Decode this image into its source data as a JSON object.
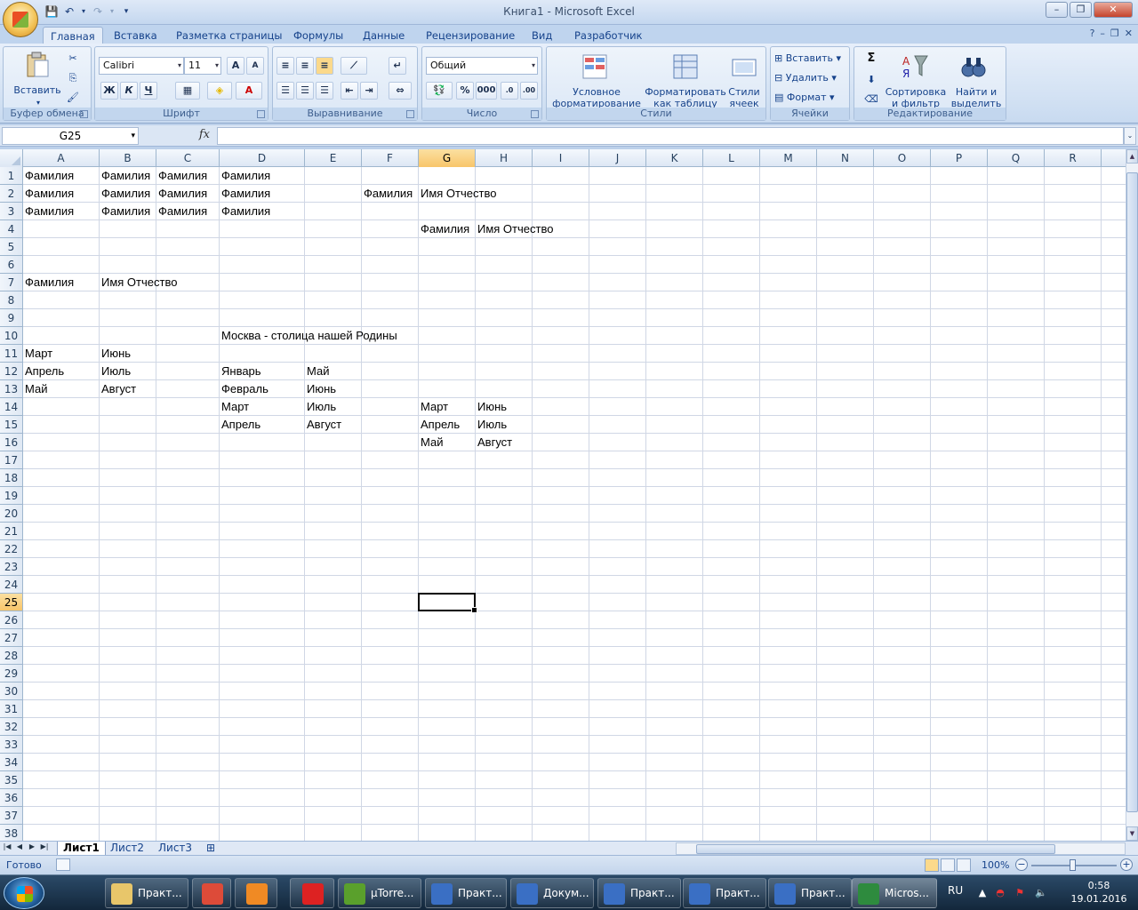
{
  "window": {
    "title": "Книга1 - Microsoft Excel"
  },
  "ribbon_tabs": [
    "Главная",
    "Вставка",
    "Разметка страницы",
    "Формулы",
    "Данные",
    "Рецензирование",
    "Вид",
    "Разработчик"
  ],
  "ribbon": {
    "clipboard": {
      "paste": "Вставить",
      "title": "Буфер обмена"
    },
    "font": {
      "name": "Calibri",
      "size": "11",
      "bold": "Ж",
      "italic": "К",
      "underline": "Ч",
      "grow": "A",
      "shrink": "A",
      "fontcolor": "A",
      "title": "Шрифт"
    },
    "alignment": {
      "title": "Выравнивание"
    },
    "number": {
      "format": "Общий",
      "percent": "%",
      "thousands": "000",
      "title": "Число"
    },
    "styles": {
      "conditional": "Условное форматирование",
      "astable": "Форматировать как таблицу",
      "cellstyles": "Стили ячеек",
      "title": "Стили"
    },
    "cells": {
      "insert": "Вставить",
      "delete": "Удалить",
      "format": "Формат",
      "title": "Ячейки"
    },
    "editing": {
      "sigma": "Σ",
      "sort": "Сортировка и фильтр",
      "find": "Найти и выделить",
      "title": "Редактирование"
    }
  },
  "formula_bar": {
    "name_box": "G25",
    "fx": "fx",
    "value": ""
  },
  "columns": [
    "A",
    "B",
    "C",
    "D",
    "E",
    "F",
    "G",
    "H",
    "I",
    "J",
    "K",
    "L",
    "M",
    "N",
    "O",
    "P",
    "Q",
    "R"
  ],
  "rows": [
    "1",
    "2",
    "3",
    "4",
    "5",
    "6",
    "7",
    "8",
    "9",
    "10",
    "11",
    "12",
    "13",
    "14",
    "15",
    "16",
    "17",
    "18",
    "19",
    "20",
    "21",
    "22",
    "23",
    "24",
    "25",
    "26",
    "27",
    "28",
    "29",
    "30",
    "31",
    "32",
    "33",
    "34",
    "35",
    "36",
    "37",
    "38"
  ],
  "selected": {
    "cell": "G25",
    "column": "G",
    "row": "25"
  },
  "cells": [
    {
      "ref": "A1",
      "v": "Фамилия"
    },
    {
      "ref": "B1",
      "v": "Фамилия"
    },
    {
      "ref": "C1",
      "v": "Фамилия"
    },
    {
      "ref": "D1",
      "v": "Фамилия"
    },
    {
      "ref": "A2",
      "v": "Фамилия"
    },
    {
      "ref": "B2",
      "v": "Фамилия"
    },
    {
      "ref": "C2",
      "v": "Фамилия"
    },
    {
      "ref": "D2",
      "v": "Фамилия"
    },
    {
      "ref": "F2",
      "v": "Фамилия"
    },
    {
      "ref": "G2",
      "v": "Имя Отчество"
    },
    {
      "ref": "A3",
      "v": "Фамилия"
    },
    {
      "ref": "B3",
      "v": "Фамилия"
    },
    {
      "ref": "C3",
      "v": "Фамилия"
    },
    {
      "ref": "D3",
      "v": "Фамилия"
    },
    {
      "ref": "G4",
      "v": "Фамилия"
    },
    {
      "ref": "H4",
      "v": "Имя Отчество"
    },
    {
      "ref": "A7",
      "v": "Фамилия"
    },
    {
      "ref": "B7",
      "v": "Имя Отчество"
    },
    {
      "ref": "D10",
      "v": "Москва - столица нашей Родины"
    },
    {
      "ref": "A11",
      "v": "Март"
    },
    {
      "ref": "B11",
      "v": "Июнь"
    },
    {
      "ref": "A12",
      "v": "Апрель"
    },
    {
      "ref": "B12",
      "v": "Июль"
    },
    {
      "ref": "D12",
      "v": "Январь"
    },
    {
      "ref": "E12",
      "v": "Май"
    },
    {
      "ref": "A13",
      "v": "Май"
    },
    {
      "ref": "B13",
      "v": "Август"
    },
    {
      "ref": "D13",
      "v": "Февраль"
    },
    {
      "ref": "E13",
      "v": "Июнь"
    },
    {
      "ref": "D14",
      "v": "Март"
    },
    {
      "ref": "E14",
      "v": "Июль"
    },
    {
      "ref": "G14",
      "v": "Март"
    },
    {
      "ref": "H14",
      "v": "Июнь"
    },
    {
      "ref": "D15",
      "v": "Апрель"
    },
    {
      "ref": "E15",
      "v": "Август"
    },
    {
      "ref": "G15",
      "v": "Апрель"
    },
    {
      "ref": "H15",
      "v": "Июль"
    },
    {
      "ref": "G16",
      "v": "Май"
    },
    {
      "ref": "H16",
      "v": "Август"
    }
  ],
  "sheets": [
    "Лист1",
    "Лист2",
    "Лист3"
  ],
  "status": {
    "ready": "Готово",
    "zoom": "100%"
  },
  "taskbar": {
    "items": [
      "Практ...",
      "",
      "",
      "",
      "µTorre...",
      "Практ...",
      "Докум...",
      "Практ...",
      "Практ...",
      "Практ...",
      "Micros..."
    ],
    "lang": "RU",
    "time": "0:58",
    "date": "19.01.2016"
  }
}
